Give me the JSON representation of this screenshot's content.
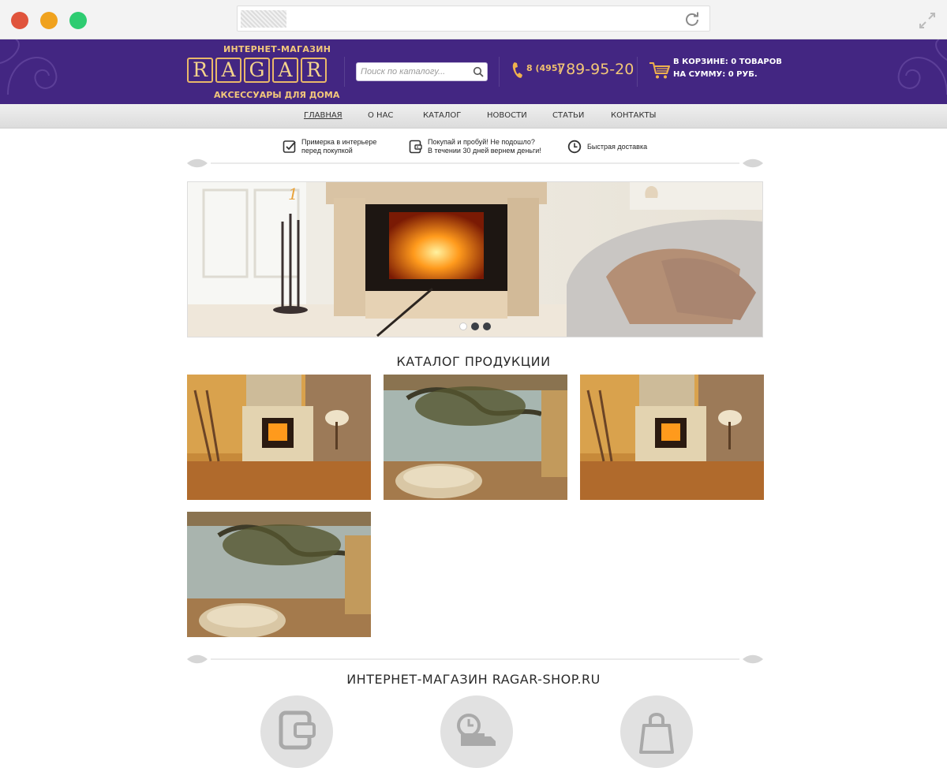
{
  "header": {
    "logo_top": "ИНТЕРНЕТ-МАГАЗИН",
    "logo_letters": [
      "R",
      "A",
      "G",
      "A",
      "R"
    ],
    "logo_bottom": "АКСЕССУАРЫ ДЛЯ ДОМА",
    "search_placeholder": "Поиск по каталогу...",
    "phone_code": "8 (495)",
    "phone_number": "789-95-20",
    "cart_line1": "В КОРЗИНЕ: 0 ТОВАРОВ",
    "cart_line2": "НА СУММУ: 0 РУБ."
  },
  "nav": {
    "items": [
      "ГЛАВНАЯ",
      "О НАС",
      "КАТАЛОГ",
      "НОВОСТИ",
      "СТАТЬИ",
      "КОНТАКТЫ"
    ],
    "active_index": 0
  },
  "features": [
    {
      "icon": "check-icon",
      "line1": "Примерка в интерьере",
      "line2": "перед покупкой"
    },
    {
      "icon": "wallet-icon",
      "line1": "Покупай и пробуй! Не подошло?",
      "line2": "В течении 30 дней вернем деньги!"
    },
    {
      "icon": "clock-icon",
      "line1": "Быстрая доставка",
      "line2": ""
    }
  ],
  "slider": {
    "slide_number": "1",
    "pages": 3,
    "active_page": 0
  },
  "catalog": {
    "title": "КАТАЛОГ ПРОДУКЦИИ",
    "cards": [
      {
        "image": "fireplace-interior"
      },
      {
        "image": "bathroom-view"
      },
      {
        "image": "fireplace-interior"
      },
      {
        "image": "bathroom-view"
      }
    ]
  },
  "about": {
    "title": "ИНТЕРНЕТ-МАГАЗИН RAGAR-SHOP.RU",
    "icons": [
      "wallet-icon",
      "delivery-truck-icon",
      "shopping-bag-icon"
    ]
  },
  "colors": {
    "header_bg": "#432682",
    "gold": "#f2c77b",
    "accent_orange": "#e8a23a"
  }
}
